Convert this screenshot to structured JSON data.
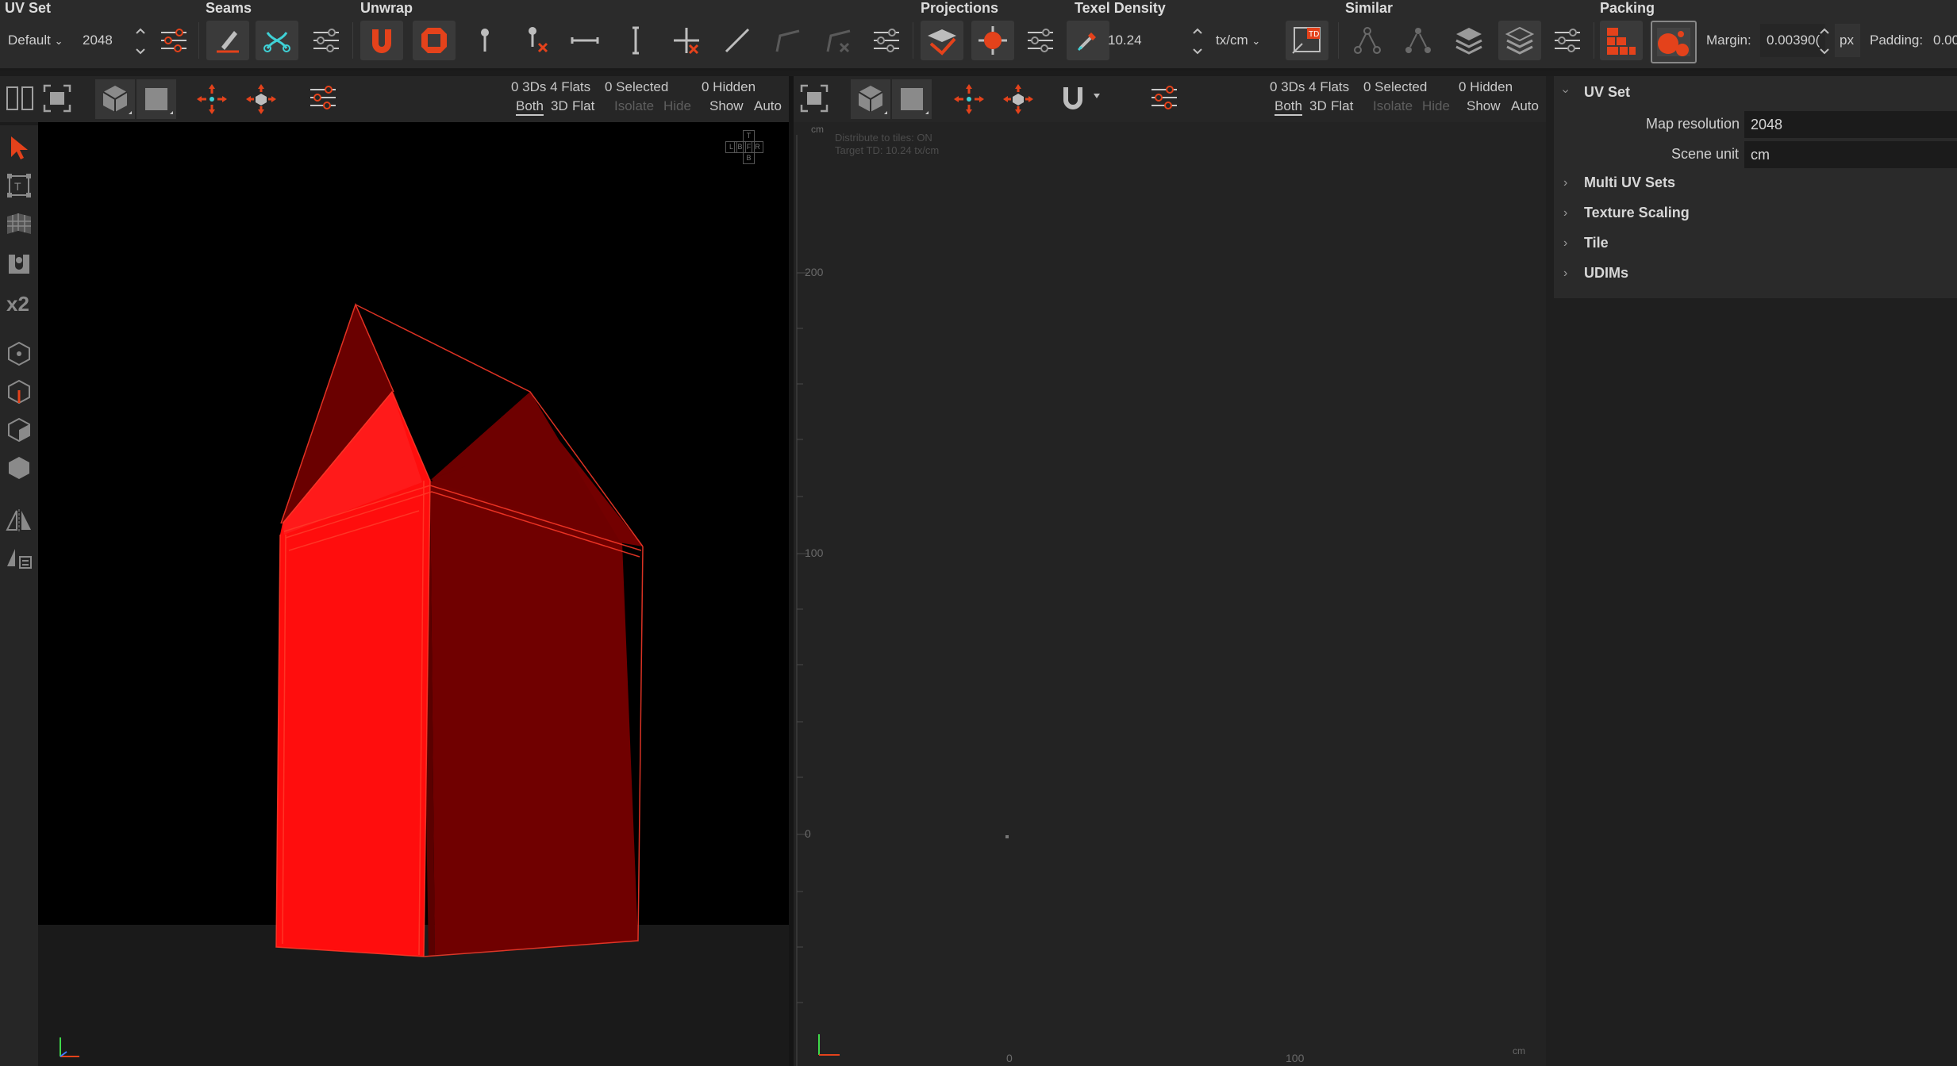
{
  "toolbar": {
    "sections": {
      "uv_set": "UV Set",
      "seams": "Seams",
      "unwrap": "Unwrap",
      "projections": "Projections",
      "texel_density": "Texel Density",
      "similar": "Similar",
      "packing": "Packing"
    },
    "uv_set_preset": "Default",
    "uv_set_resolution": "2048",
    "texel_density_value": "10.24",
    "texel_density_unit": "tx/cm",
    "margin_label": "Margin:",
    "margin_value": "0.00390(",
    "margin_unit": "px",
    "padding_label": "Padding:",
    "padding_value": "0.00"
  },
  "viewport3d": {
    "stats": {
      "counts": "0 3Ds 4 Flats",
      "selected": "0 Selected",
      "hidden": "0 Hidden"
    },
    "modes": {
      "both": "Both",
      "three_d": "3D",
      "flat": "Flat",
      "isolate": "Isolate",
      "hide": "Hide",
      "show": "Show",
      "auto": "Auto"
    },
    "navcube": {
      "top": "T",
      "left": "L",
      "back": "B",
      "front": "F",
      "right": "R",
      "bottom": "B"
    }
  },
  "viewportuv": {
    "stats": {
      "counts": "0 3Ds 4 Flats",
      "selected": "0 Selected",
      "hidden": "0 Hidden"
    },
    "modes": {
      "both": "Both",
      "three_d": "3D",
      "flat": "Flat",
      "isolate": "Isolate",
      "hide": "Hide",
      "show": "Show",
      "auto": "Auto"
    },
    "info_line1": "Distribute to tiles: ON",
    "info_line2": "Target TD: 10.24 tx/cm",
    "unit_top": "cm",
    "unit_bottom": "cm",
    "y_ticks": [
      "200",
      "100",
      "0"
    ],
    "x_ticks": [
      "0",
      "100"
    ]
  },
  "panel": {
    "title": "UV Set",
    "map_resolution_label": "Map resolution",
    "map_resolution_value": "2048",
    "scene_unit_label": "Scene unit",
    "scene_unit_value": "cm",
    "sections": [
      "Multi UV Sets",
      "Texture Scaling",
      "Tile",
      "UDIMs"
    ]
  },
  "colors": {
    "accent": "#e4421b",
    "mesh_front": "#ff0d0d",
    "mesh_side": "#730000"
  }
}
